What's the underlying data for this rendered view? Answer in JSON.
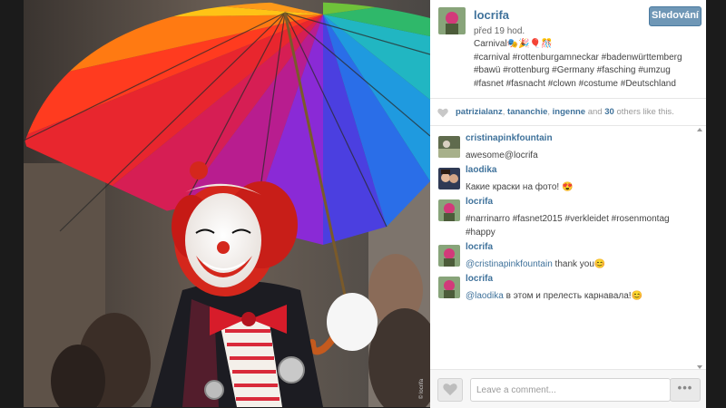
{
  "post": {
    "author": "locrifa",
    "follow_label": "Sledování",
    "time": "před 19 hod.",
    "caption_title": "Carnival🎭🎉🎈🎊",
    "caption_tags": "#carnival #rottenburgamneckar #badenwürttemberg #bawü #rottenburg #Germany #fasching #umzug #fasnet #fasnacht #clown #costume #Deutschland"
  },
  "likes": {
    "user1": "patrizialanz",
    "user2": "tananchie",
    "user3": "ingenne",
    "and_text": "and",
    "count": "30",
    "suffix": "others like this."
  },
  "comments": [
    {
      "user": "cristinapinkfountain",
      "text": "awesome@locrifa"
    },
    {
      "user": "laodika",
      "text": "Какие краски на фото! 😍"
    },
    {
      "user": "locrifa",
      "text": "#narrinarro #fasnet2015 #verkleidet #rosenmontag #happy"
    },
    {
      "user": "locrifa",
      "mention": "@cristinapinkfountain",
      "text": " thank you😊"
    },
    {
      "user": "locrifa",
      "mention": "@laodika",
      "text": " в этом и прелесть карнавала!😊"
    }
  ],
  "footer": {
    "comment_placeholder": "Leave a comment...",
    "more_label": "•••"
  },
  "photo": {
    "watermark": "© locrifa"
  },
  "colors": {
    "link": "#3f729b",
    "follow_button": "#6f97b6"
  },
  "icons": {
    "like": "heart-icon",
    "more": "ellipsis-icon"
  }
}
